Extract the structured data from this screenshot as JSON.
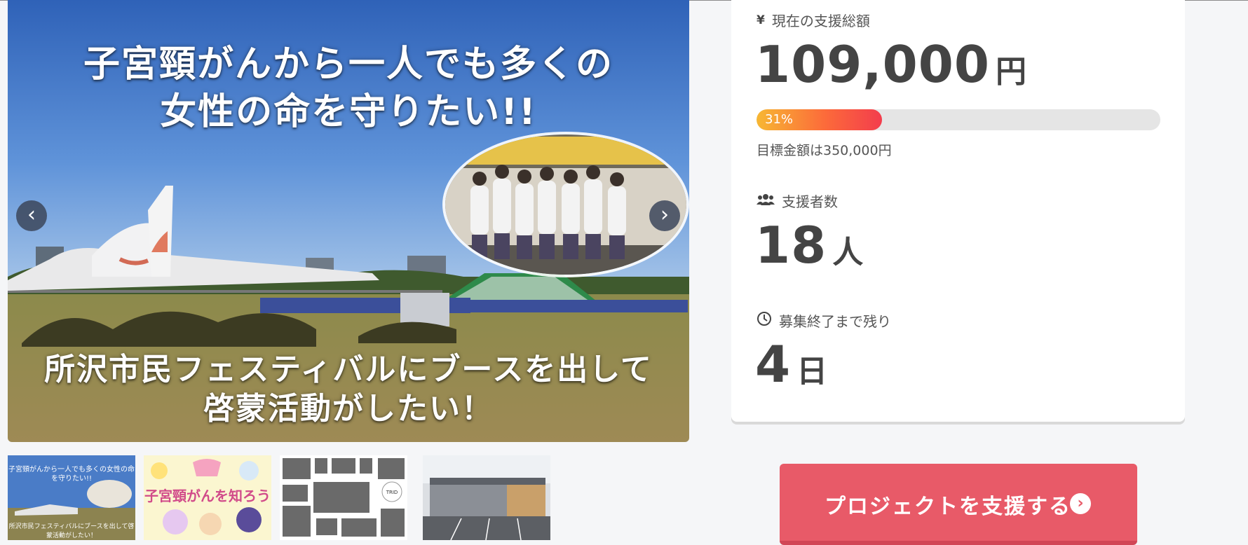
{
  "slider": {
    "caption_top_line1": "子宮頸がんから一人でも多くの",
    "caption_top_line2": "女性の命を守りたい!!",
    "caption_bottom_line1": "所沢市民フェスティバルにブースを出して",
    "caption_bottom_line2": "啓蒙活動がしたい！",
    "prev_icon": "chevron-left-icon",
    "next_icon": "chevron-right-icon"
  },
  "thumbnails": [
    {
      "caption_top": "子宮頸がんから一人でも多くの女性の命を守りたい!!",
      "caption_bottom": "所沢市民フェスティバルにブースを出して啓蒙活動がしたい！"
    },
    {
      "title": "子宮頸がんを知ろう"
    },
    {
      "badge": "TRID"
    },
    {}
  ],
  "stats": {
    "total_label": "現在の支援総額",
    "total_icon": "yen-icon",
    "total_value": "109,000",
    "total_unit": "円",
    "progress_percent": 31,
    "progress_text": "31%",
    "goal_text": "目標金額は350,000円",
    "supporters_label": "支援者数",
    "supporters_icon": "users-icon",
    "supporters_value": "18",
    "supporters_unit": "人",
    "remaining_label": "募集終了まで残り",
    "remaining_icon": "clock-icon",
    "remaining_value": "4",
    "remaining_unit": "日"
  },
  "support_button": {
    "label": "プロジェクトを支援する",
    "icon": "chevron-right-circle-icon"
  },
  "colors": {
    "accent": "#e85a68",
    "progress_start": "#f7b733",
    "progress_end": "#f33d4d"
  }
}
